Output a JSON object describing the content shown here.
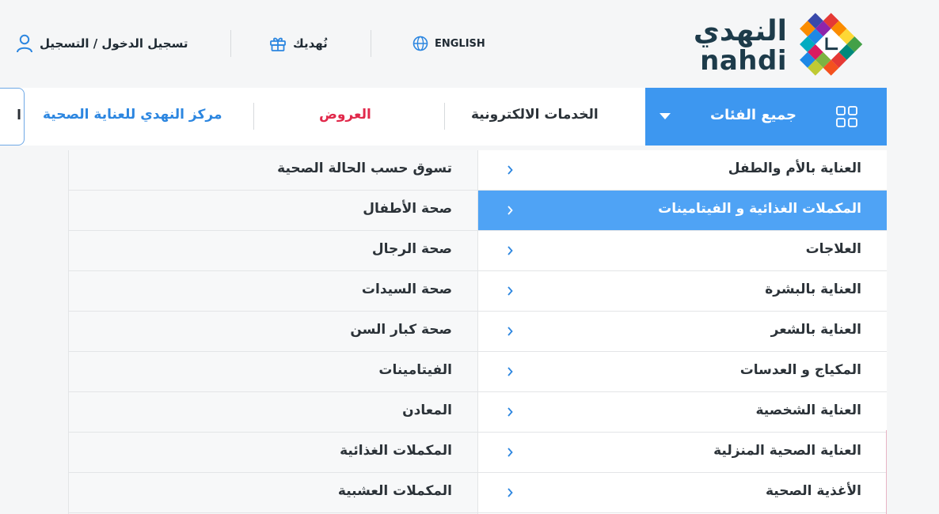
{
  "header": {
    "logo_ar": "النهدي",
    "logo_en": "nahdi",
    "language_label": "ENGLISH",
    "gift_label": "نُهديك",
    "login_label": "تسجيل الدخول / التسجيل"
  },
  "nav": {
    "all_categories_label": "جميع الفئات",
    "items": [
      {
        "label": "الخدمات الالكترونية",
        "color": "#2b3238"
      },
      {
        "label": "العروض",
        "color": "#e1294b"
      },
      {
        "label": "مركز النهدي للعناية الصحية",
        "color": "#2c86e0"
      }
    ],
    "edge_label": "ا"
  },
  "menu": {
    "main": [
      {
        "label": "العناية بالأم والطفل"
      },
      {
        "label": "المكملات الغذائية و الفيتامينات",
        "active": true
      },
      {
        "label": "العلاجات"
      },
      {
        "label": "العناية بالبشرة"
      },
      {
        "label": "العناية بالشعر"
      },
      {
        "label": "المكياج و العدسات"
      },
      {
        "label": "العناية الشخصية"
      },
      {
        "label": "العناية الصحية المنزلية"
      },
      {
        "label": "الأغذية الصحية"
      }
    ],
    "sub": [
      {
        "label": "تسوق حسب الحالة الصحية"
      },
      {
        "label": "صحة الأطفال"
      },
      {
        "label": "صحة الرجال"
      },
      {
        "label": "صحة السيدات"
      },
      {
        "label": "صحة كبار السن"
      },
      {
        "label": "الفيتامينات"
      },
      {
        "label": "المعادن"
      },
      {
        "label": "المكملات الغذائية"
      },
      {
        "label": "المكملات العشبية"
      }
    ]
  },
  "icons": {
    "globe": "globe-icon",
    "gift": "gift-icon",
    "user": "user-icon",
    "grid": "grid-icon",
    "caret": "caret-down-icon",
    "chevron": "chevron-right-icon"
  },
  "colors": {
    "accent": "#3d97f0",
    "active_row": "#4fa3f5",
    "offers": "#e1294b",
    "health_center": "#2c86e0",
    "brand_dark": "#1d3b4a"
  }
}
